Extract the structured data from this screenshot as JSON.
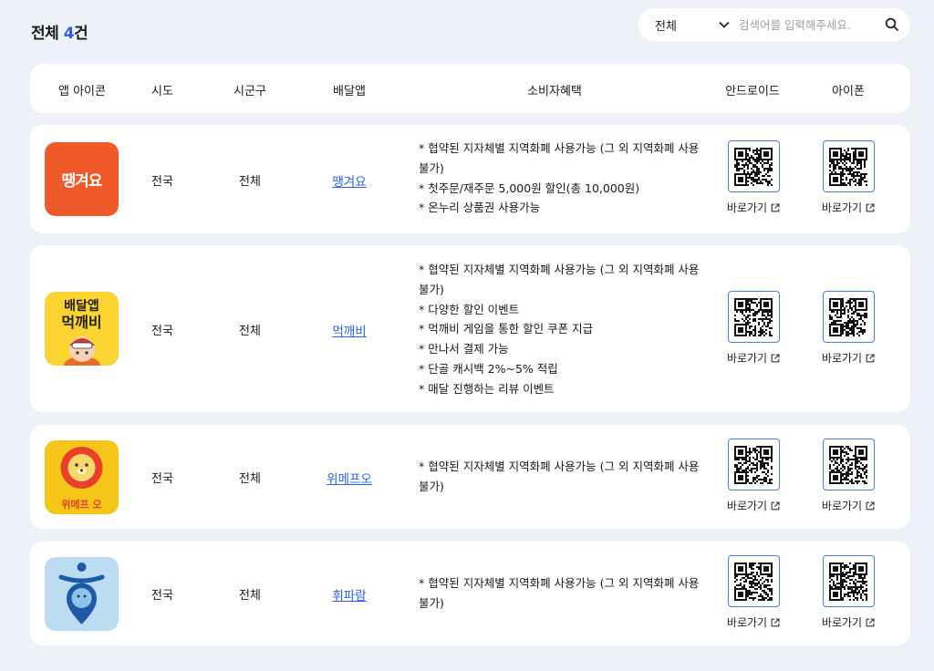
{
  "summary": {
    "label": "전체",
    "count": "4",
    "unit": "건"
  },
  "search": {
    "filter_value": "전체",
    "placeholder": "검색어를 입력해주세요."
  },
  "table": {
    "headers": [
      "앱 아이콘",
      "시도",
      "시군구",
      "배달앱",
      "소비자혜택",
      "안드로이드",
      "아이폰"
    ],
    "link_label": "바로가기",
    "rows": [
      {
        "sido": "전국",
        "sigungu": "전체",
        "app": "땡겨요",
        "icon_text": "땡겨요",
        "benefits": [
          "* 협약된 지자체별 지역화폐 사용가능 (그 외 지역화폐 사용불가)",
          "* 첫주문/재주문 5,000원 할인(총 10,000원)",
          "* 온누리 상품권 사용가능"
        ]
      },
      {
        "sido": "전국",
        "sigungu": "전체",
        "app": "먹깨비",
        "icon_text_top": "배달앱",
        "icon_text_bottom": "먹깨비",
        "benefits": [
          "* 협약된 지자체별 지역화폐 사용가능 (그 외 지역화폐 사용불가)",
          "* 다양한 할인 이벤트",
          "* 먹깨비 게임을 통한 할인 쿠폰 지급",
          "* 만나서 결제 가능",
          "* 단골 캐시백 2%~5% 적립",
          "* 매달 진행하는 리뷰 이벤트"
        ]
      },
      {
        "sido": "전국",
        "sigungu": "전체",
        "app": "위메프오",
        "icon_text": "위메프 오",
        "benefits": [
          "* 협약된 지자체별 지역화폐 사용가능 (그 외 지역화폐 사용불가)"
        ]
      },
      {
        "sido": "전국",
        "sigungu": "전체",
        "app": "휘파람",
        "benefits": [
          "* 협약된 지자체별 지역화폐 사용가능 (그 외 지역화폐 사용불가)"
        ]
      }
    ]
  },
  "colors": {
    "accent": "#2b5fe8",
    "background": "#eef1f8",
    "ttaengyeoyo": "#f05a28",
    "meokkaebi": "#fcd431",
    "wemakeprice": "#f5c518",
    "hwiparam": "#bcdcf2"
  }
}
